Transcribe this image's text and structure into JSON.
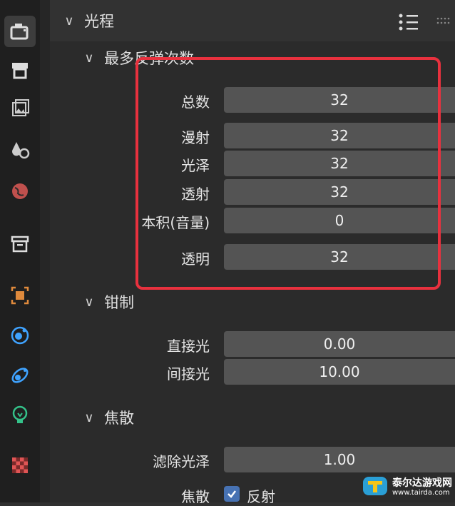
{
  "sections": {
    "light_paths": "光程",
    "max_bounces": "最多反弹次数",
    "clamping": "钳制",
    "caustics": "焦散"
  },
  "bounces": [
    {
      "label": "总数",
      "value": "32"
    },
    {
      "label": "漫射",
      "value": "32"
    },
    {
      "label": "光泽",
      "value": "32"
    },
    {
      "label": "透射",
      "value": "32"
    },
    {
      "label": "本积(音量)",
      "value": "0"
    },
    {
      "label": "透明",
      "value": "32"
    }
  ],
  "clamping": [
    {
      "label": "直接光",
      "value": "0.00"
    },
    {
      "label": "间接光",
      "value": "10.00"
    }
  ],
  "caustics": {
    "filter_label": "滤除光泽",
    "filter_value": "1.00",
    "caustics_label": "焦散",
    "reflective_label": "反射",
    "reflective_checked": true
  },
  "sidebar_icons": [
    "render-icon",
    "output-icon",
    "view-layer-icon",
    "scene-icon",
    "world-icon",
    "collection-icon",
    "object-icon",
    "modifier-icon",
    "particles-icon",
    "physics-icon",
    "texture-icon"
  ],
  "colors": {
    "highlight": "#e8313e",
    "accent": "#4772b3",
    "object": "#e08a3c",
    "world": "#c0504d",
    "physics": "#3fa3ff"
  },
  "watermark": {
    "name": "泰尔达游戏网",
    "url": "www.tairda.com"
  }
}
